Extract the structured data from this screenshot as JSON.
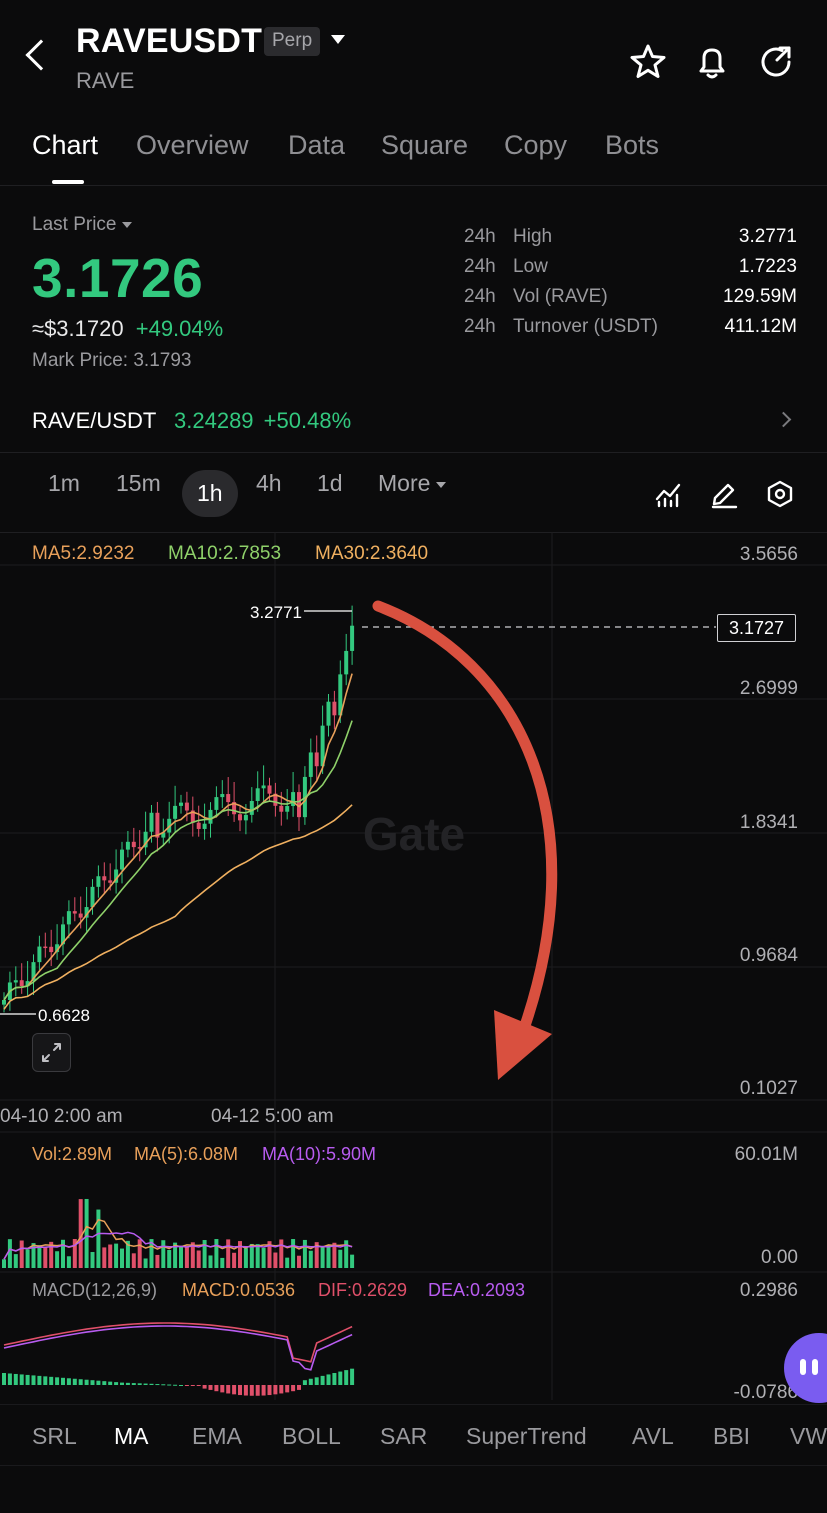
{
  "header": {
    "symbol": "RAVEUSDT",
    "contract_type": "Perp",
    "subtitle": "RAVE",
    "icons": [
      "back-arrow-icon",
      "star-icon",
      "bell-icon",
      "share-icon"
    ]
  },
  "tabs": [
    {
      "label": "Chart",
      "active": true
    },
    {
      "label": "Overview"
    },
    {
      "label": "Data"
    },
    {
      "label": "Square"
    },
    {
      "label": "Copy"
    },
    {
      "label": "Bots"
    }
  ],
  "price": {
    "last_price_label": "Last Price",
    "last_price": "3.1726",
    "usd_approx": "≈$3.1720",
    "change": "+49.04%",
    "mark_price": "Mark Price: 3.1793"
  },
  "stats": [
    {
      "period": "24h",
      "label": "High",
      "value": "3.2771"
    },
    {
      "period": "24h",
      "label": "Low",
      "value": "1.7223"
    },
    {
      "period": "24h",
      "label": "Vol (RAVE)",
      "value": "129.59M"
    },
    {
      "period": "24h",
      "label": "Turnover (USDT)",
      "value": "411.12M"
    }
  ],
  "spot_pair": {
    "label": "RAVE/USDT",
    "price": "3.24289",
    "change": "+50.48%"
  },
  "timeframes": [
    {
      "label": "1m"
    },
    {
      "label": "15m"
    },
    {
      "label": "1h",
      "active": true
    },
    {
      "label": "4h"
    },
    {
      "label": "1d"
    },
    {
      "label": "More"
    }
  ],
  "chart_tools": [
    "indicator-icon",
    "pencil-icon",
    "settings-hex-icon"
  ],
  "ma_legend": {
    "ma5": "MA5:2.9232",
    "ma10": "MA10:2.7853",
    "ma30": "MA30:2.3640"
  },
  "price_axis": [
    "3.5656",
    "2.6999",
    "1.8341",
    "0.9684",
    "0.1027"
  ],
  "price_tag": "3.1727",
  "high_marker": "3.2771",
  "low_marker": "0.6628",
  "watermark": "Gate",
  "time_axis": [
    "04-10 2:00 am",
    "04-12 5:00 am"
  ],
  "volume_legend": {
    "vol": "Vol:2.89M",
    "ma5": "MA(5):6.08M",
    "ma10": "MA(10):5.90M"
  },
  "volume_axis": [
    "60.01M",
    "0.00"
  ],
  "macd_legend": {
    "params": "MACD(12,26,9)",
    "macd": "MACD:0.0536",
    "dif": "DIF:0.2629",
    "dea": "DEA:0.2093"
  },
  "macd_axis": [
    "0.2986",
    "-0.0786"
  ],
  "indicators": [
    {
      "label": "SRL"
    },
    {
      "label": "MA",
      "active": true
    },
    {
      "label": "EMA"
    },
    {
      "label": "BOLL"
    },
    {
      "label": "SAR"
    },
    {
      "label": "SuperTrend"
    },
    {
      "label": "AVL"
    },
    {
      "label": "BBI"
    },
    {
      "label": "VW"
    }
  ],
  "colors": {
    "up": "#33c97f",
    "down": "#e0506a",
    "ma5": "#e8a05a",
    "ma10": "#8fd16a",
    "ma30": "#f0b060",
    "arrow": "#d9503f",
    "purple": "#b85cf0"
  }
}
